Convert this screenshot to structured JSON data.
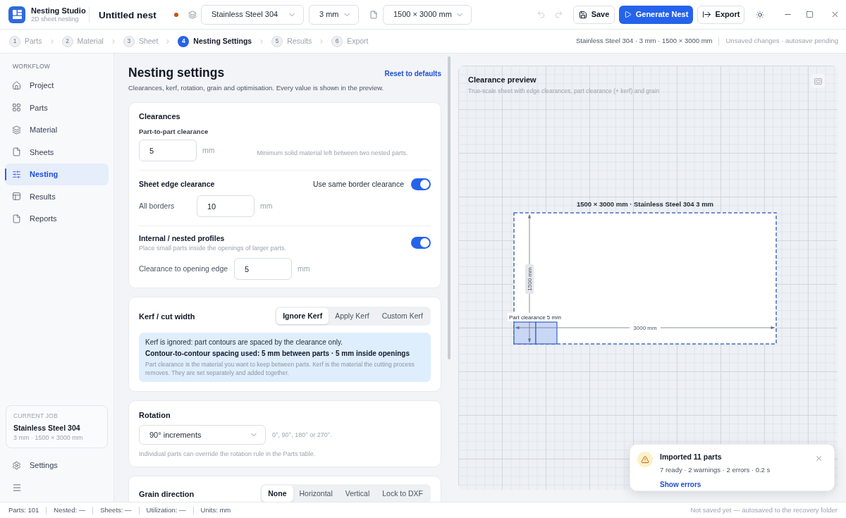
{
  "app": {
    "name": "Nesting Studio",
    "tagline": "2D sheet nesting"
  },
  "document": {
    "title": "Untitled nest",
    "unsaved": true
  },
  "toolbar": {
    "material": "Stainless Steel 304",
    "thickness": "3 mm",
    "sheet_size": "1500 × 3000 mm",
    "undo": {
      "disabled": true
    },
    "redo": {
      "disabled": true
    },
    "save": "Save",
    "generate": "Generate Nest",
    "export": "Export"
  },
  "steps": [
    {
      "number": "1",
      "label": "Parts",
      "selected": false
    },
    {
      "number": "2",
      "label": "Material",
      "selected": false
    },
    {
      "number": "3",
      "label": "Sheet",
      "selected": false
    },
    {
      "number": "4",
      "label": "Nesting Settings",
      "selected": true
    },
    {
      "number": "5",
      "label": "Results",
      "selected": false
    },
    {
      "number": "6",
      "label": "Export",
      "selected": false
    }
  ],
  "job_summary": {
    "details": "Stainless Steel 304 · 3 mm · 1500 × 3000 mm",
    "save_state": "Unsaved changes · autosave pending"
  },
  "sidebar": {
    "heading": "WORKFLOW",
    "items": [
      {
        "label": "Project",
        "selected": false
      },
      {
        "label": "Parts",
        "selected": false
      },
      {
        "label": "Material",
        "selected": false
      },
      {
        "label": "Sheets",
        "selected": false
      },
      {
        "label": "Nesting",
        "selected": true
      },
      {
        "label": "Results",
        "selected": false
      },
      {
        "label": "Reports",
        "selected": false
      }
    ],
    "current_job": {
      "heading": "CURRENT JOB",
      "title": "Stainless Steel 304",
      "detail": "3 mm · 1500 × 3000 mm"
    },
    "settings": "Settings"
  },
  "settings": {
    "title": "Nesting settings",
    "subtitle": "Clearances, kerf, rotation, grain and optimisation. Every value is shown in the preview.",
    "reset": "Reset to defaults",
    "clearances": {
      "title": "Clearances",
      "part_to_part": {
        "label": "Part-to-part clearance",
        "value": "5",
        "unit": "mm",
        "hint": "Minimum solid material left between two nested parts."
      },
      "sheet_edge": {
        "title": "Sheet edge clearance",
        "same_border": {
          "label": "Use same border clearance",
          "on": true
        },
        "all_borders": {
          "label": "All borders",
          "value": "10",
          "unit": "mm"
        }
      },
      "internal": {
        "title": "Internal / nested profiles",
        "description": "Place small parts inside the openings of larger parts.",
        "on": true,
        "opening": {
          "label": "Clearance to opening edge",
          "value": "5",
          "unit": "mm"
        }
      }
    },
    "kerf": {
      "title": "Kerf / cut width",
      "options": [
        {
          "label": "Ignore Kerf",
          "selected": true
        },
        {
          "label": "Apply Kerf",
          "selected": false
        },
        {
          "label": "Custom Kerf",
          "selected": false
        }
      ],
      "info": {
        "line_1": "Kerf is ignored: part contours are spaced by the clearance only.",
        "line_2": "Contour-to-contour spacing used: 5 mm between parts · 5 mm inside openings",
        "note": "Part clearance is the material you want to keep between parts. Kerf is the material the cutting process removes. They are set separately and added together."
      }
    },
    "rotation": {
      "title": "Rotation",
      "value": "90° increments",
      "hint": "0°, 90°, 180° or 270°.",
      "note": "Individual parts can override the rotation rule in the Parts table."
    },
    "grain": {
      "title": "Grain direction",
      "options": [
        {
          "label": "None",
          "selected": true
        },
        {
          "label": "Horizontal",
          "selected": false
        },
        {
          "label": "Vertical",
          "selected": false
        },
        {
          "label": "Lock to DXF",
          "selected": false
        }
      ]
    }
  },
  "preview": {
    "title": "Clearance preview",
    "subtitle": "True-scale sheet with edge clearances, part clearance (+ kerf) and grain",
    "sheet_label": "1500 × 3000 mm · Stainless Steel 304 3 mm",
    "height_label": "1500 mm",
    "width_label": "3000 mm",
    "clearance_label": "Part clearance 5 mm"
  },
  "toast": {
    "title": "Imported 11 parts",
    "detail": "7 ready · 2 warnings · 2 errors · 0.2 s",
    "action": "Show errors"
  },
  "status_bar": {
    "items": [
      "Parts: 101",
      "Nested: —",
      "Sheets: —",
      "Utilization: —",
      "Units: mm"
    ],
    "message": "Not saved yet — autosaved to the recovery folder"
  }
}
